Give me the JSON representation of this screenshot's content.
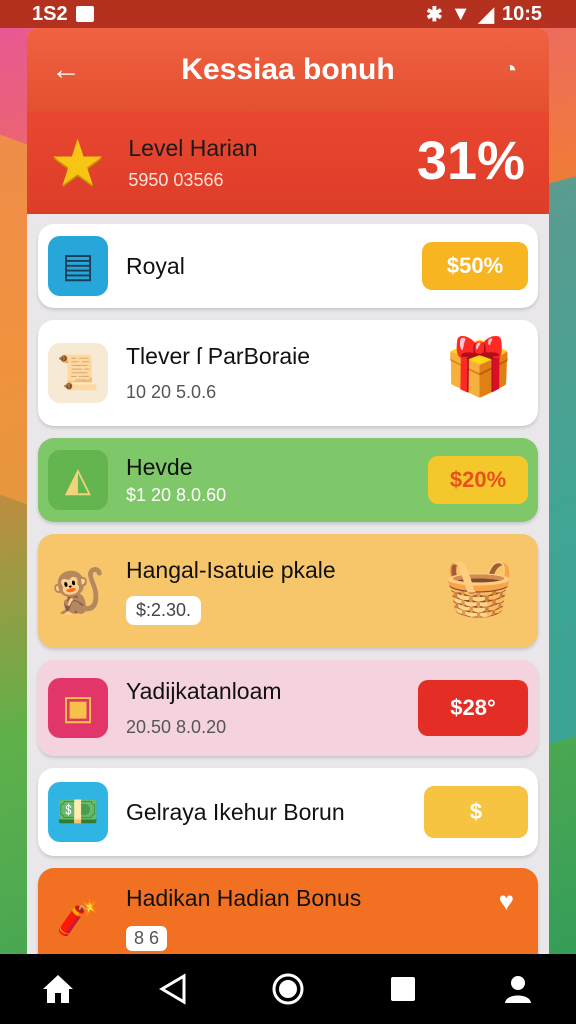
{
  "status": {
    "time_left": "1S2",
    "time_right": "10:5"
  },
  "header": {
    "title": "Kessiaa bonuh"
  },
  "level": {
    "title": "Level Harian",
    "code": "5950 03566",
    "percent": "31%"
  },
  "items": [
    {
      "name": "Royal",
      "badge": "$50%"
    },
    {
      "name": "Tlever ſ ParBoraie",
      "sub": "10 20 5.0.6"
    },
    {
      "name": "Hevde",
      "sub": "$1 20 8.0.60",
      "badge": "$20%"
    },
    {
      "name": "Hangal-Isatuie pkale",
      "sub": "$:2.30."
    },
    {
      "name": "Yadijkatanloam",
      "sub": "20.50 8.0.20",
      "badge": "$28°"
    },
    {
      "name": "Gelraya Ikehur Borun",
      "badge": "$"
    },
    {
      "name": "Hadikan Hadian Bonus",
      "sub": "8 6"
    }
  ],
  "colors": {
    "accent": "#e4502f",
    "green": "#7fc86a",
    "yellow": "#f8c66a",
    "pink": "#f4d3df"
  },
  "icons": [
    "back-arrow-icon",
    "profile-icon",
    "star-icon",
    "calculator-icon",
    "scroll-icon",
    "gift-icon",
    "nacho-icon",
    "monkey-icon",
    "basket-icon",
    "frame-icon",
    "money-icon",
    "cracker-icon",
    "heart-icon",
    "home-icon",
    "back-icon",
    "circle-home-icon",
    "square-recents-icon",
    "person-icon"
  ]
}
